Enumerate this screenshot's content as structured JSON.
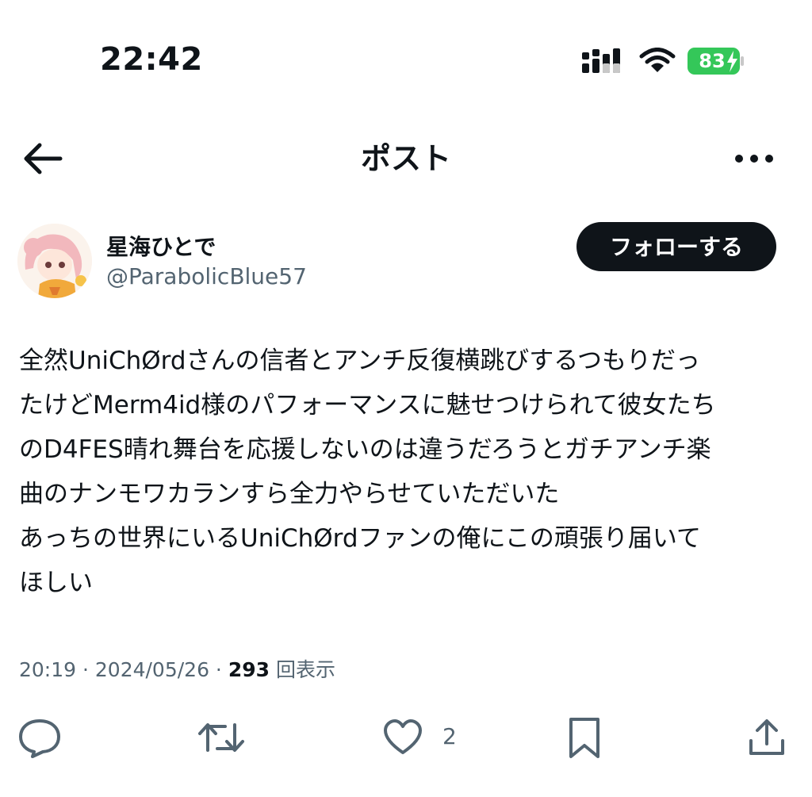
{
  "status_bar": {
    "time": "22:42",
    "battery_percent": "83",
    "battery_color": "#34c759",
    "icons": [
      "cellular-signal-icon",
      "wifi-icon",
      "battery-charging-icon"
    ]
  },
  "nav": {
    "title": "ポスト",
    "back_icon": "arrow-left-icon",
    "more_icon": "more-horizontal-icon"
  },
  "author": {
    "display_name": "星海ひとで",
    "handle": "@ParabolicBlue57",
    "follow_label": "フォローする"
  },
  "post": {
    "text": "全然UniChØrdさんの信者とアンチ反復横跳びするつもりだっ\nたけどMerm4id様のパフォーマンスに魅せつけられて彼女たち\nのD4FES晴れ舞台を応援しないのは違うだろうとガチアンチ楽\n曲のナンモワカランすら全力やらせていただいた\nあっちの世界にいるUniChØrdファンの俺にこの頑張り届いて\nほしい",
    "time": "20:19",
    "date": "2024/05/26",
    "separator": " · ",
    "views_count": "293",
    "views_label": "回表示"
  },
  "actions": {
    "reply_icon": "reply-icon",
    "repost_icon": "repost-icon",
    "like_icon": "heart-icon",
    "like_count": "2",
    "bookmark_icon": "bookmark-icon",
    "share_icon": "share-icon"
  }
}
